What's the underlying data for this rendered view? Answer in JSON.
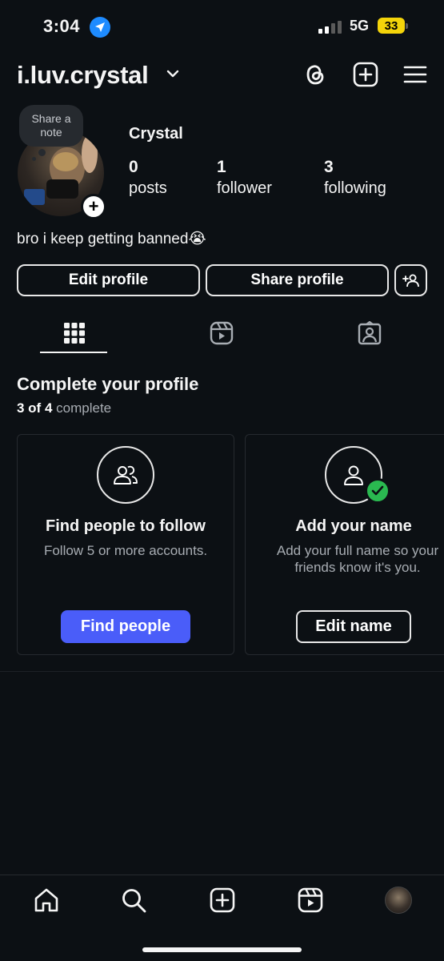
{
  "status_bar": {
    "time": "3:04",
    "network": "5G",
    "battery": "33"
  },
  "header": {
    "username": "i.luv.crystal"
  },
  "profile": {
    "note": "Share a note",
    "display_name": "Crystal",
    "stats": [
      {
        "value": "0",
        "label": "posts"
      },
      {
        "value": "1",
        "label": "follower"
      },
      {
        "value": "3",
        "label": "following"
      }
    ],
    "bio": "bro i keep getting banned😭"
  },
  "buttons": {
    "edit_profile": "Edit profile",
    "share_profile": "Share profile"
  },
  "complete_profile": {
    "title": "Complete your profile",
    "count": "3 of 4",
    "suffix": "complete",
    "cards": [
      {
        "title": "Find people to follow",
        "desc": "Follow 5 or more accounts.",
        "button": "Find people"
      },
      {
        "title": "Add your name",
        "desc": "Add your full name so your friends know it's you.",
        "button": "Edit name"
      }
    ]
  },
  "colors": {
    "background": "#0c1014",
    "accent": "#4a5df9",
    "success": "#2ab950",
    "location": "#1e8bff",
    "battery": "#f4d40a"
  }
}
